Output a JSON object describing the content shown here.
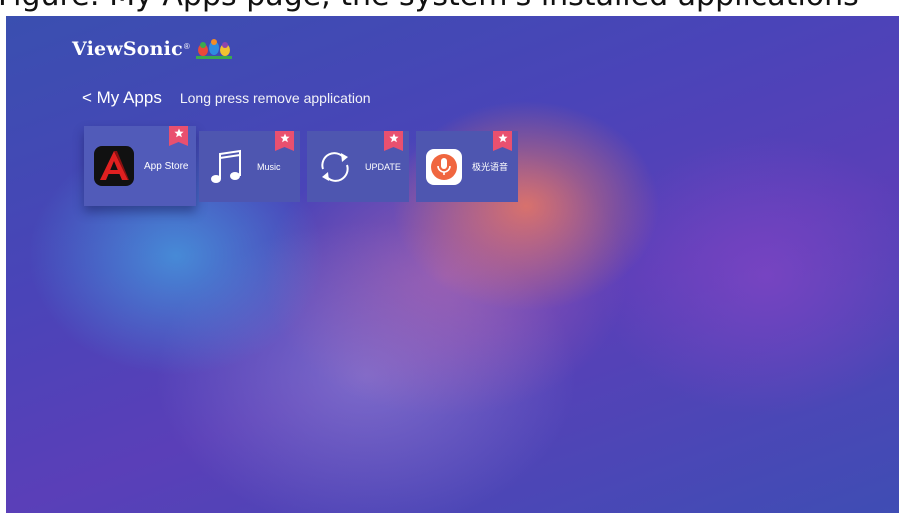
{
  "banner": {
    "text": "Figure: My Apps page, the system's installed applications"
  },
  "brand": {
    "name": "ViewSonic",
    "mark": "®"
  },
  "nav": {
    "back_label": "< My Apps",
    "hint": "Long press remove application"
  },
  "apps": [
    {
      "label": "App Store",
      "icon": "app-store-icon",
      "favorite": true,
      "focused": true
    },
    {
      "label": "Music",
      "icon": "music-note-icon",
      "favorite": true,
      "focused": false
    },
    {
      "label": "UPDATE",
      "icon": "refresh-icon",
      "favorite": true,
      "focused": false
    },
    {
      "label": "极光语音",
      "icon": "microphone-icon",
      "favorite": true,
      "focused": false
    }
  ],
  "colors": {
    "tile": "#4e56b0",
    "favorite_badge": "#e9506f",
    "app_store_accent": "#e02020",
    "voice_accent": "#f0663f"
  }
}
